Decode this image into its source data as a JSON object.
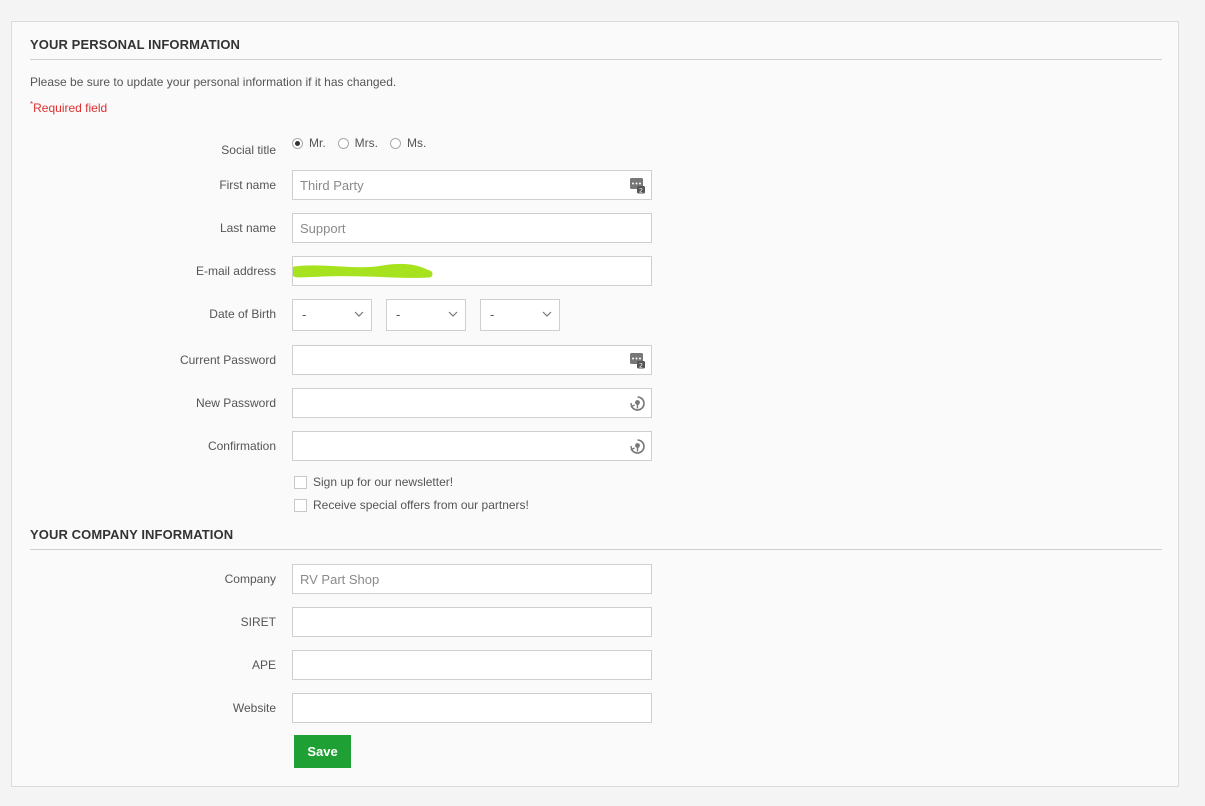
{
  "personal": {
    "title": "YOUR PERSONAL INFORMATION",
    "intro": "Please be sure to update your personal information if it has changed.",
    "required_mark": "*",
    "required_text": "Required field",
    "social_title": {
      "label": "Social title",
      "options": [
        "Mr.",
        "Mrs.",
        "Ms."
      ],
      "selected": "Mr."
    },
    "first_name": {
      "label": "First name",
      "value": "Third Party",
      "icon": "password-manager-icon"
    },
    "last_name": {
      "label": "Last name",
      "value": "Support"
    },
    "email": {
      "label": "E-mail address",
      "value": "",
      "note": "value obscured by green redaction scribble"
    },
    "dob": {
      "label": "Date of Birth",
      "day": "-",
      "month": "-",
      "year": "-"
    },
    "current_password": {
      "label": "Current Password",
      "value": "",
      "icon": "password-manager-icon"
    },
    "new_password": {
      "label": "New Password",
      "value": "",
      "icon": "key-refresh-icon"
    },
    "confirmation": {
      "label": "Confirmation",
      "value": "",
      "icon": "key-refresh-icon"
    },
    "newsletter_label": "Sign up for our newsletter!",
    "partners_label": "Receive special offers from our partners!"
  },
  "company": {
    "title": "YOUR COMPANY INFORMATION",
    "company": {
      "label": "Company",
      "value": "RV Part Shop"
    },
    "siret": {
      "label": "SIRET",
      "value": ""
    },
    "ape": {
      "label": "APE",
      "value": ""
    },
    "website": {
      "label": "Website",
      "value": ""
    }
  },
  "actions": {
    "save_label": "Save"
  },
  "colors": {
    "required": "#e0302f",
    "save_button": "#1ea035",
    "redaction": "#a6e21d"
  }
}
